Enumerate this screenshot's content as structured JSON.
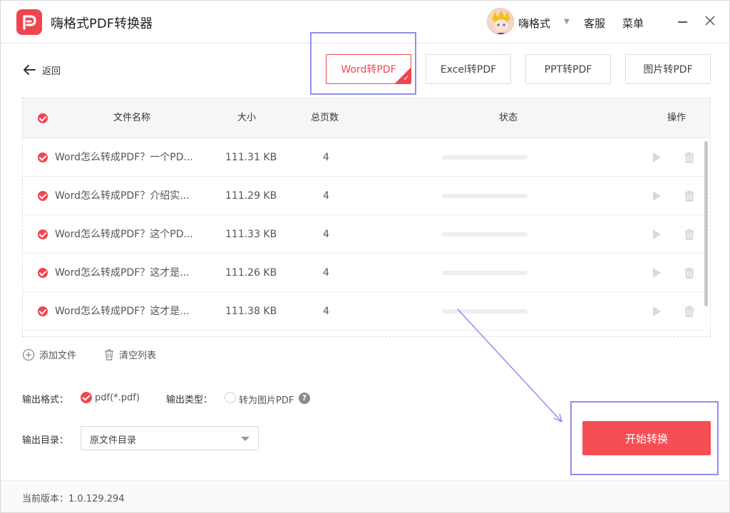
{
  "app": {
    "title": "嗨格式PDF转换器",
    "username": "嗨格式",
    "service_label": "客服",
    "menu_label": "菜单"
  },
  "nav": {
    "back_label": "返回",
    "tabs": [
      {
        "label": "Word转PDF",
        "active": true
      },
      {
        "label": "Excel转PDF",
        "active": false
      },
      {
        "label": "PPT转PDF",
        "active": false
      },
      {
        "label": "图片转PDF",
        "active": false
      }
    ]
  },
  "table": {
    "headers": {
      "name": "文件名称",
      "size": "大小",
      "pages": "总页数",
      "status": "状态",
      "actions": "操作"
    },
    "rows": [
      {
        "name": "Word怎么转成PDF？一个PD...",
        "size": "111.31 KB",
        "pages": "4",
        "progress": 0
      },
      {
        "name": "Word怎么转成PDF？介绍实...",
        "size": "111.29 KB",
        "pages": "4",
        "progress": 0
      },
      {
        "name": "Word怎么转成PDF？这个PD...",
        "size": "111.33 KB",
        "pages": "4",
        "progress": 0
      },
      {
        "name": "Word怎么转成PDF？这才是...",
        "size": "111.26 KB",
        "pages": "4",
        "progress": 0
      },
      {
        "name": "Word怎么转成PDF？这才是...",
        "size": "111.38 KB",
        "pages": "4",
        "progress": 0
      }
    ]
  },
  "actions": {
    "add_file": "添加文件",
    "clear_list": "清空列表"
  },
  "options": {
    "format_label": "输出格式：",
    "format_value": "pdf(*.pdf)",
    "type_label": "输出类型：",
    "type_value": "转为图片PDF",
    "help_glyph": "?",
    "dir_label": "输出目录：",
    "dir_value": "原文件目录"
  },
  "start_button": "开始转换",
  "footer": {
    "version": "当前版本：1.0.129.294"
  },
  "colors": {
    "accent": "#f0454f",
    "annotation": "#8f8ef0"
  }
}
